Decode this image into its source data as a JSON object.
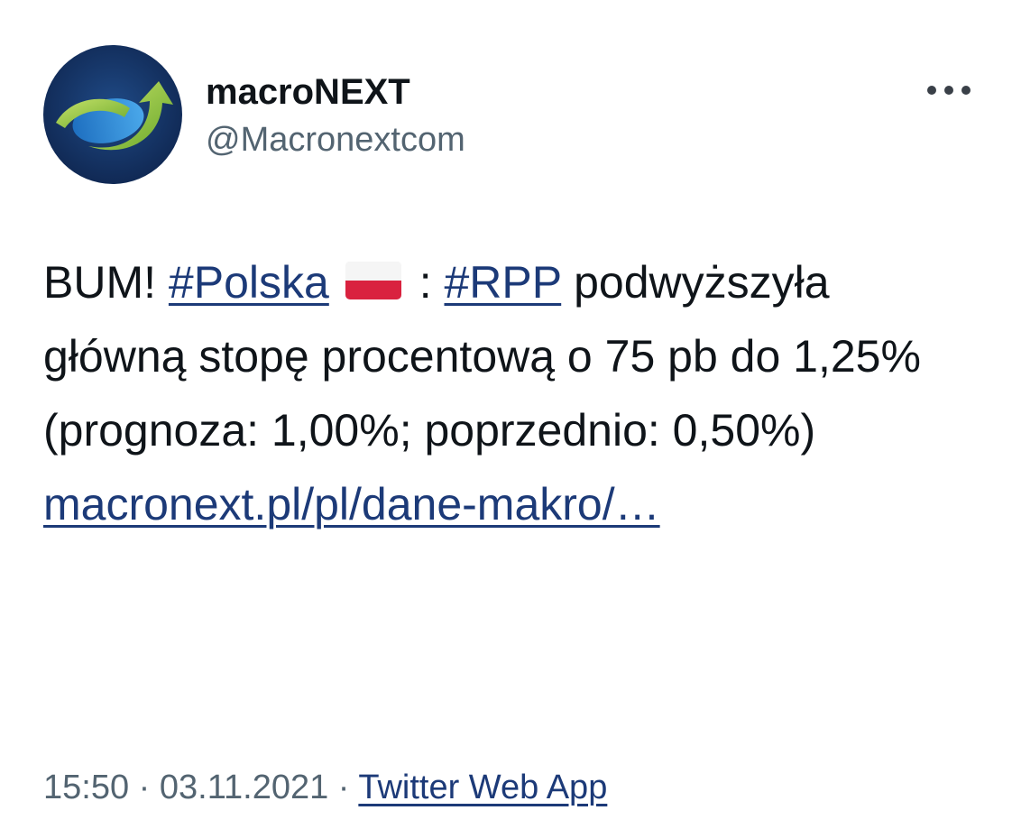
{
  "account": {
    "display_name": "macroNEXT",
    "handle": "@Macronextcom",
    "avatar_icon": "macronext-logo-icon"
  },
  "menu": {
    "icon": "more-icon"
  },
  "tweet": {
    "prefix": "BUM! ",
    "hashtag_1": "#Polska",
    "flag_icon": "poland-flag-icon",
    "separator": " : ",
    "hashtag_2": "#RPP",
    "body": " podwyższyła główną stopę procentową o 75 pb do 1,25% (prognoza: 1,00%; poprzednio: 0,50%) ",
    "link": "macronext.pl/pl/dane-makro/…"
  },
  "meta": {
    "time": "15:50",
    "dot": " · ",
    "date": "03.11.2021",
    "source": "Twitter Web App"
  },
  "colors": {
    "link": "#1c3a78",
    "secondary_text": "#536471",
    "avatar_bg": "#16305c",
    "logo_green": "#8cc63f"
  }
}
